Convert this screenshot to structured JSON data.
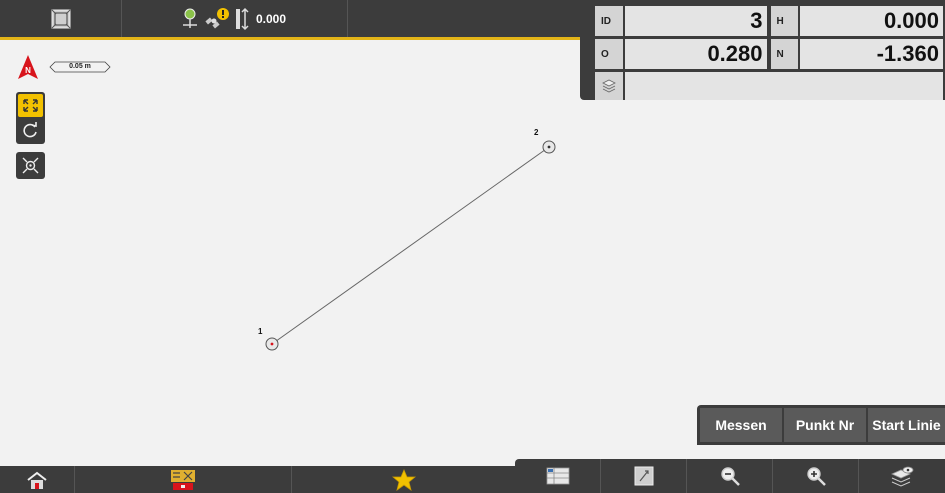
{
  "topbar": {
    "icons": [
      "drawing-icon",
      "gnss-icon",
      "satellite-warning-icon",
      "pole-height-icon"
    ],
    "height_value": "0.000"
  },
  "info_panel": {
    "id_label": "ID",
    "id_value": "3",
    "h_label": "H",
    "h_value": "0.000",
    "o_label": "O",
    "o_value": "0.280",
    "n_label": "N",
    "n_value": "-1.360",
    "layer_value": ""
  },
  "map": {
    "scale_label": "0.05 m",
    "points": [
      {
        "label": "1"
      },
      {
        "label": "2"
      }
    ]
  },
  "actions": {
    "measure_label": "Messen",
    "point_number_label": "Punkt Nr",
    "start_line_label": "Start Linie"
  },
  "bottombar": {
    "icons": [
      "home-icon",
      "tools-icon",
      "favorites-icon",
      "list-icon",
      "calculator-icon",
      "zoom-out-icon",
      "zoom-in-icon",
      "layers-icon"
    ]
  },
  "colors": {
    "accent": "#e3b418",
    "bar": "#3c3c3c",
    "fit_button": "#f2c100",
    "north_arrow": "#d8141c"
  }
}
